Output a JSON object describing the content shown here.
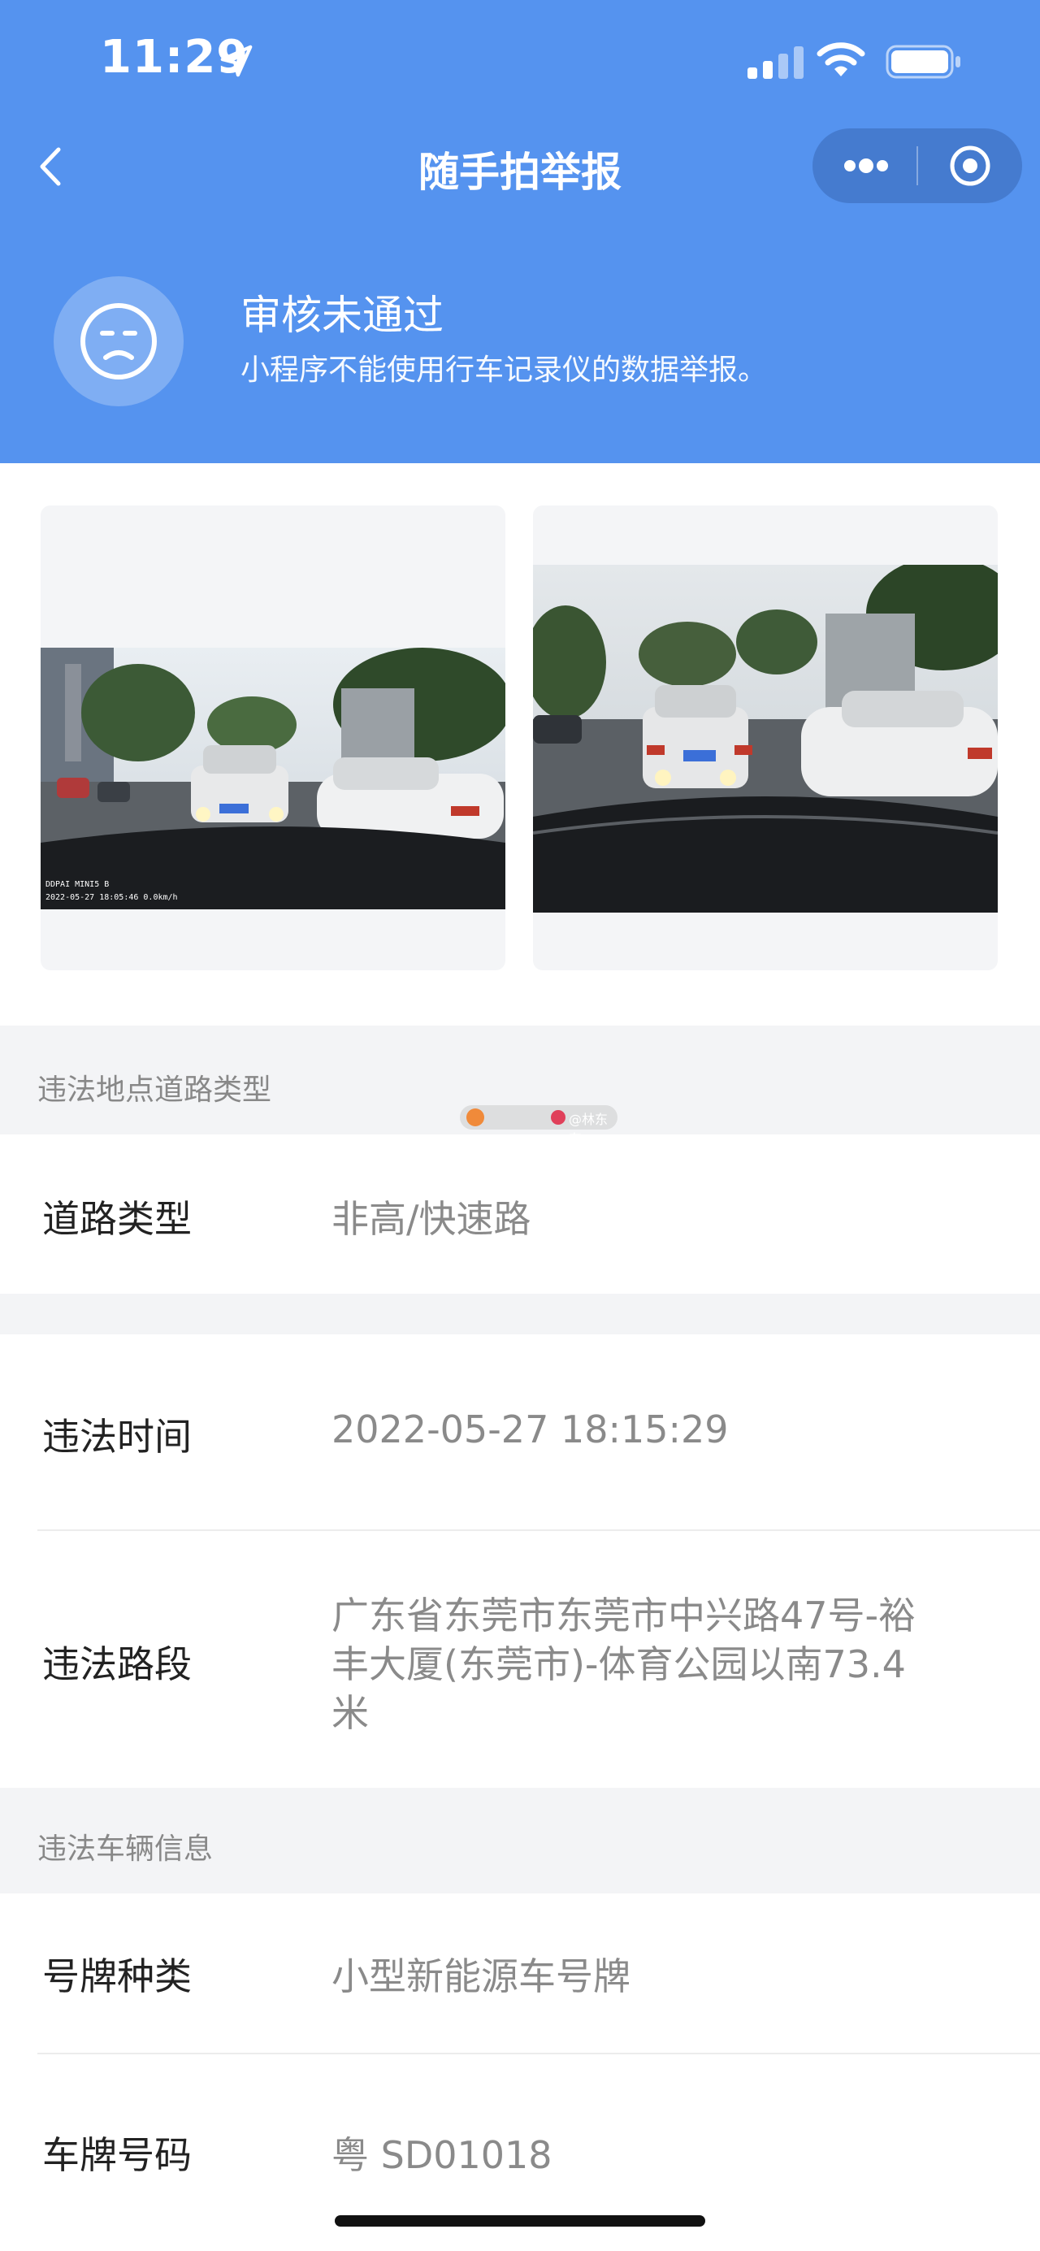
{
  "status_bar": {
    "time": "11:29"
  },
  "nav": {
    "title": "随手拍举报"
  },
  "review": {
    "title": "审核未通过",
    "description": "小程序不能使用行车记录仪的数据举报。"
  },
  "photos": [
    {
      "caption_brand": "DDPAI MINI5 B",
      "caption_info": "2022-05-27 18:05:46  0.0km/h"
    },
    {
      "caption_brand": "",
      "caption_info": ""
    }
  ],
  "sections": {
    "location_header": "违法地点道路类型",
    "road_type": {
      "label": "道路类型",
      "value": "非高/快速路"
    },
    "time": {
      "label": "违法时间",
      "value": "2022-05-27 18:15:29"
    },
    "segment": {
      "label": "违法路段",
      "value_lines": [
        "广东省东莞市东莞市中兴路47号-裕",
        "丰大厦(东莞市)-体育公园以南73.4",
        "米"
      ]
    },
    "vehicle_header": "违法车辆信息",
    "plate_type": {
      "label": "号牌种类",
      "value": "小型新能源车号牌"
    },
    "plate_number": {
      "label": "车牌号码",
      "value": "粤 SD01018"
    }
  },
  "watermark": {
    "text": "@林东东"
  },
  "colors": {
    "header_bg": "#5593ef",
    "section_bg": "#f3f4f6"
  }
}
